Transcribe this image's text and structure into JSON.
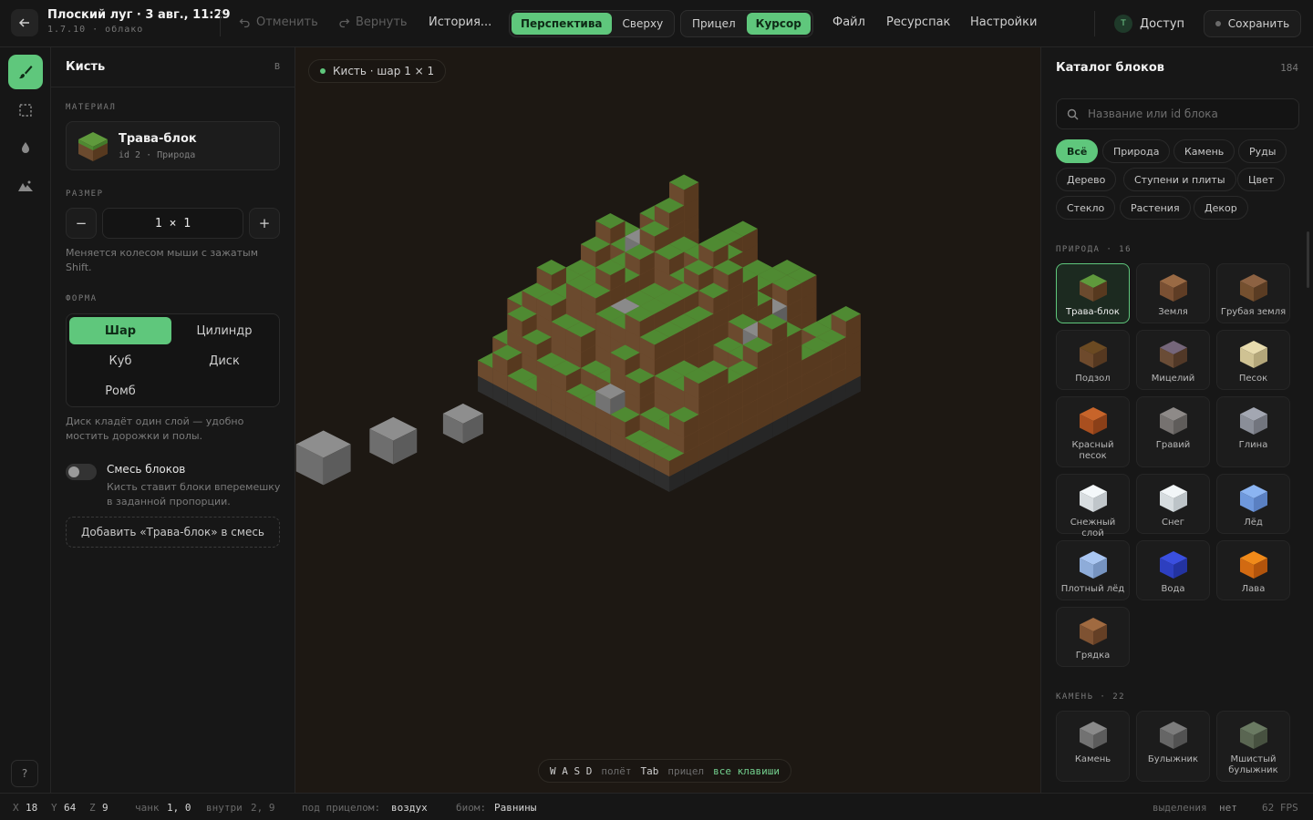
{
  "header": {
    "title": "Плоский луг · 3 авг., 11:29",
    "subtitle": "1.7.10 · облако",
    "undo_label": "Отменить",
    "redo_label": "Вернуть",
    "history_label": "История...",
    "view_modes": [
      "Перспектива",
      "Сверху"
    ],
    "active_view": "Перспектива",
    "input_modes": [
      "Прицел",
      "Курсор"
    ],
    "active_input": "Курсор",
    "menu": [
      "Файл",
      "Ресурспак",
      "Настройки"
    ],
    "access_avatar": "T",
    "access_label": "Доступ",
    "save_label": "Сохранить"
  },
  "rail": {
    "tools": [
      "brush-icon",
      "selection-icon",
      "drop-icon",
      "terrain-icon"
    ],
    "active_tool": "brush-icon",
    "help_label": "?"
  },
  "brush_panel": {
    "title": "Кисть",
    "shortcut": "B",
    "material_label": "МАТЕРИАЛ",
    "material_name": "Трава-блок",
    "material_sub": "id 2 · Природа",
    "size_label": "РАЗМЕР",
    "size_value": "1 × 1",
    "minus_label": "−",
    "plus_label": "+",
    "size_hint": "Меняется колесом мыши с зажатым Shift.",
    "shape_label": "ФОРМА",
    "shapes": [
      "Шар",
      "Цилиндр",
      "Куб",
      "Диск",
      "Ромб"
    ],
    "active_shape": "Шар",
    "shape_hint": "Диск кладёт один слой — удобно мостить дорожки и полы.",
    "mix_title": "Смесь блоков",
    "mix_enabled": false,
    "mix_desc": "Кисть ставит блоки вперемешку в заданной пропорции.",
    "add_mix_label": "Добавить «Трава-блок» в смесь"
  },
  "viewport": {
    "badge": "Кисть · шар 1 × 1",
    "keys": "W A S D",
    "keys_action": "полёт",
    "tab_key": "Tab",
    "tab_action": "прицел",
    "all_keys_link": "все клавиши"
  },
  "catalog": {
    "title": "Каталог блоков",
    "count": "184",
    "search_placeholder": "Название или id блока",
    "filters": [
      "Всё",
      "Природа",
      "Камень",
      "Руды",
      "Дерево",
      "Ступени и плиты",
      "Цвет",
      "Стекло",
      "Растения",
      "Декор"
    ],
    "active_filter": "Всё",
    "nature_label": "ПРИРОДА · 16",
    "nature_blocks": [
      {
        "name": "Трава-блок",
        "top": "#5f9a3c",
        "left": "#6b4a2e",
        "right": "#57391f"
      },
      {
        "name": "Земля",
        "top": "#9a6a44",
        "left": "#7a5033",
        "right": "#5f3d25"
      },
      {
        "name": "Грубая земля",
        "top": "#8d6242",
        "left": "#75502f",
        "right": "#5a3c23"
      },
      {
        "name": "Подзол",
        "top": "#6b4a22",
        "left": "#6e4a2c",
        "right": "#553820"
      },
      {
        "name": "Мицелий",
        "top": "#75667a",
        "left": "#6a4c36",
        "right": "#513827"
      },
      {
        "name": "Песок",
        "top": "#e8dcae",
        "left": "#cfc293",
        "right": "#b3a67a"
      },
      {
        "name": "Красный песок",
        "top": "#c7642a",
        "left": "#a94f1f",
        "right": "#8a3f18"
      },
      {
        "name": "Гравий",
        "top": "#8e8a88",
        "left": "#767270",
        "right": "#5f5c5a"
      },
      {
        "name": "Глина",
        "top": "#a3a7b2",
        "left": "#8a8e98",
        "right": "#72757e"
      },
      {
        "name": "Снежный слой",
        "top": "#f4f8fa",
        "left": "#d8dde0",
        "right": "#c0c6ca"
      },
      {
        "name": "Снег",
        "top": "#f2f6f8",
        "left": "#d6dcdf",
        "right": "#bdc4c8"
      },
      {
        "name": "Лёд",
        "top": "#8bb4f2",
        "left": "#6e98dc",
        "right": "#5a80c2"
      },
      {
        "name": "Плотный лёд",
        "top": "#a9c6f2",
        "left": "#8eacd9",
        "right": "#7693c0"
      },
      {
        "name": "Вода",
        "top": "#3a4fe0",
        "left": "#2d3fc0",
        "right": "#2333a0"
      },
      {
        "name": "Лава",
        "top": "#f08a1a",
        "left": "#d26a12",
        "right": "#b2540c"
      },
      {
        "name": "Грядка",
        "top": "#a06a40",
        "left": "#7e5232",
        "right": "#643f25"
      }
    ],
    "stone_label": "КАМЕНЬ · 22",
    "stone_blocks": [
      {
        "name": "Камень",
        "top": "#8a8a8a",
        "left": "#727272",
        "right": "#5c5c5c"
      },
      {
        "name": "Булыжник",
        "top": "#7c7c7c",
        "left": "#666666",
        "right": "#525252"
      },
      {
        "name": "Мшистый булыжник",
        "top": "#6a7a62",
        "left": "#5a6652",
        "right": "#475140"
      }
    ]
  },
  "statusbar": {
    "x_label": "X",
    "x": "18",
    "y_label": "Y",
    "y": "64",
    "z_label": "Z",
    "z": "9",
    "chunk_label": "чанк",
    "chunk": "1, 0",
    "inside_label": "внутри",
    "inside": "2, 9",
    "target_label": "под прицелом:",
    "target": "воздух",
    "biome_label": "биом:",
    "biome": "Равнины",
    "selection_label": "выделения",
    "selection": "нет",
    "fps": "62 FPS"
  },
  "colors": {
    "accent": "#5fc77c",
    "grass": "#4f8a32",
    "dirt": "#6e4a2e",
    "stone": "#7a7a7a",
    "viewport_bg": "#1d1813"
  }
}
